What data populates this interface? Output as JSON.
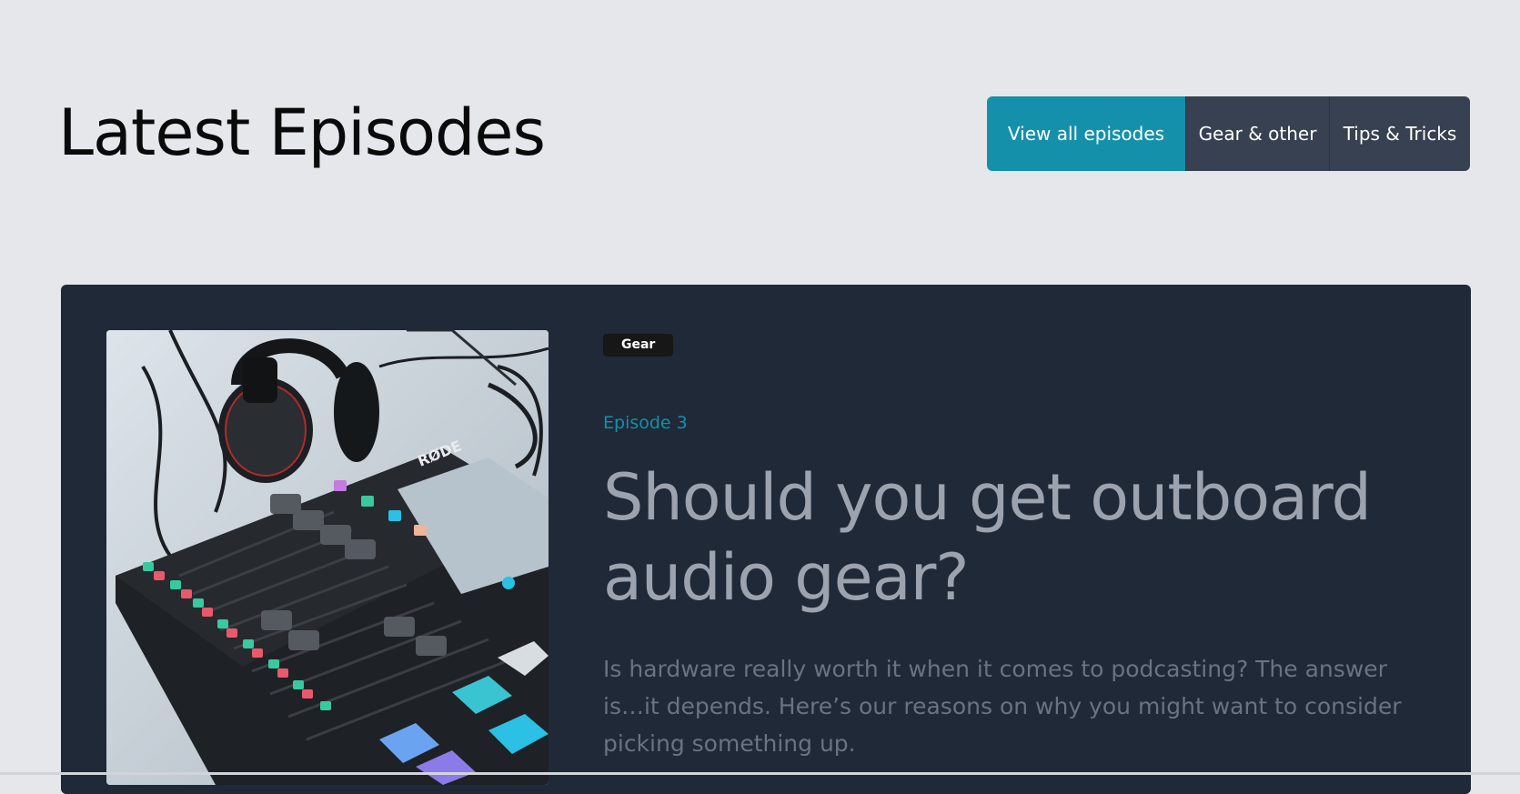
{
  "header": {
    "title": "Latest Episodes",
    "filters": [
      {
        "label": "View all episodes",
        "active": true
      },
      {
        "label": "Gear & other",
        "active": false
      },
      {
        "label": "Tips & Tricks",
        "active": false
      }
    ]
  },
  "episode": {
    "tag": "Gear",
    "number": "Episode 3",
    "title": "Should you get outboard audio gear?",
    "description": "Is hardware really worth it when it comes to podcasting? The answer is…it depends. Here’s our reasons on why you might want to consider picking something up.",
    "image_label": "RØDE"
  },
  "colors": {
    "page_bg": "#e5e7eb",
    "accent": "#1590ab",
    "card_bg": "#1f2937",
    "filter_bg": "#374151"
  }
}
